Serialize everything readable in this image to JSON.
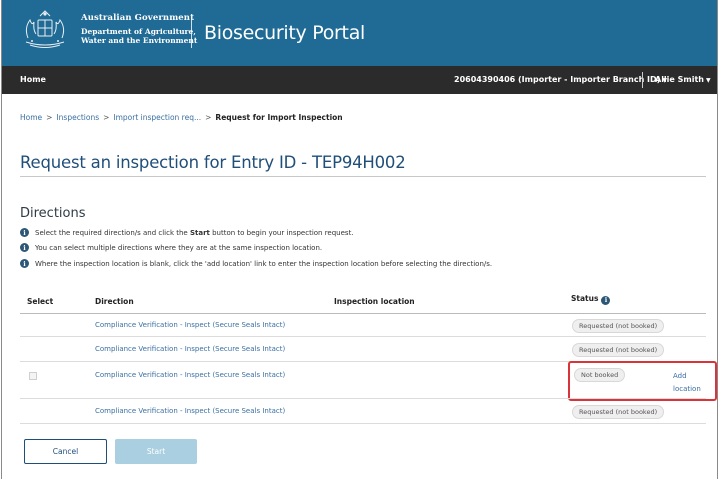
{
  "header": {
    "gov_line1": "Australian Government",
    "gov_line2": "Department of Agriculture,",
    "gov_line3": "Water and the Environment",
    "portal_title": "Biosecurity Portal",
    "brand_color": "#1f6b96"
  },
  "navbar": {
    "home": "Home",
    "account": "20604390406 (Importer - Importer Branch ID)",
    "user": "Allie Smith"
  },
  "breadcrumb": {
    "items": [
      "Home",
      "Inspections",
      "Import inspection req..."
    ],
    "current": "Request for Import Inspection"
  },
  "page_title": "Request an inspection for Entry ID - TEP94H002",
  "directions": {
    "title": "Directions",
    "info1_pre": "Select the required direction/s and click the ",
    "info1_bold": "Start",
    "info1_post": " button to begin your inspection request.",
    "info2": "You can select multiple directions where they are at the same inspection location.",
    "info3": "Where the inspection location is blank, click the 'add location' link to enter the inspection location before selecting the direction/s."
  },
  "table": {
    "headers": {
      "select": "Select",
      "direction": "Direction",
      "location": "Inspection location",
      "status": "Status"
    },
    "rows": [
      {
        "direction": "Compliance Verification - Inspect (Secure Seals Intact)",
        "status": "Requested (not booked)"
      },
      {
        "direction": "Compliance Verification - Inspect (Secure Seals Intact)",
        "status": "Requested (not booked)"
      },
      {
        "direction": "Compliance Verification - Inspect (Secure Seals Intact)",
        "status": "Not booked",
        "action": "Add location"
      },
      {
        "direction": "Compliance Verification - Inspect (Secure Seals Intact)",
        "status": "Requested (not booked)"
      }
    ]
  },
  "buttons": {
    "cancel": "Cancel",
    "start": "Start"
  },
  "icons": {
    "info": "info-icon",
    "caret": "chevron-down-icon"
  }
}
